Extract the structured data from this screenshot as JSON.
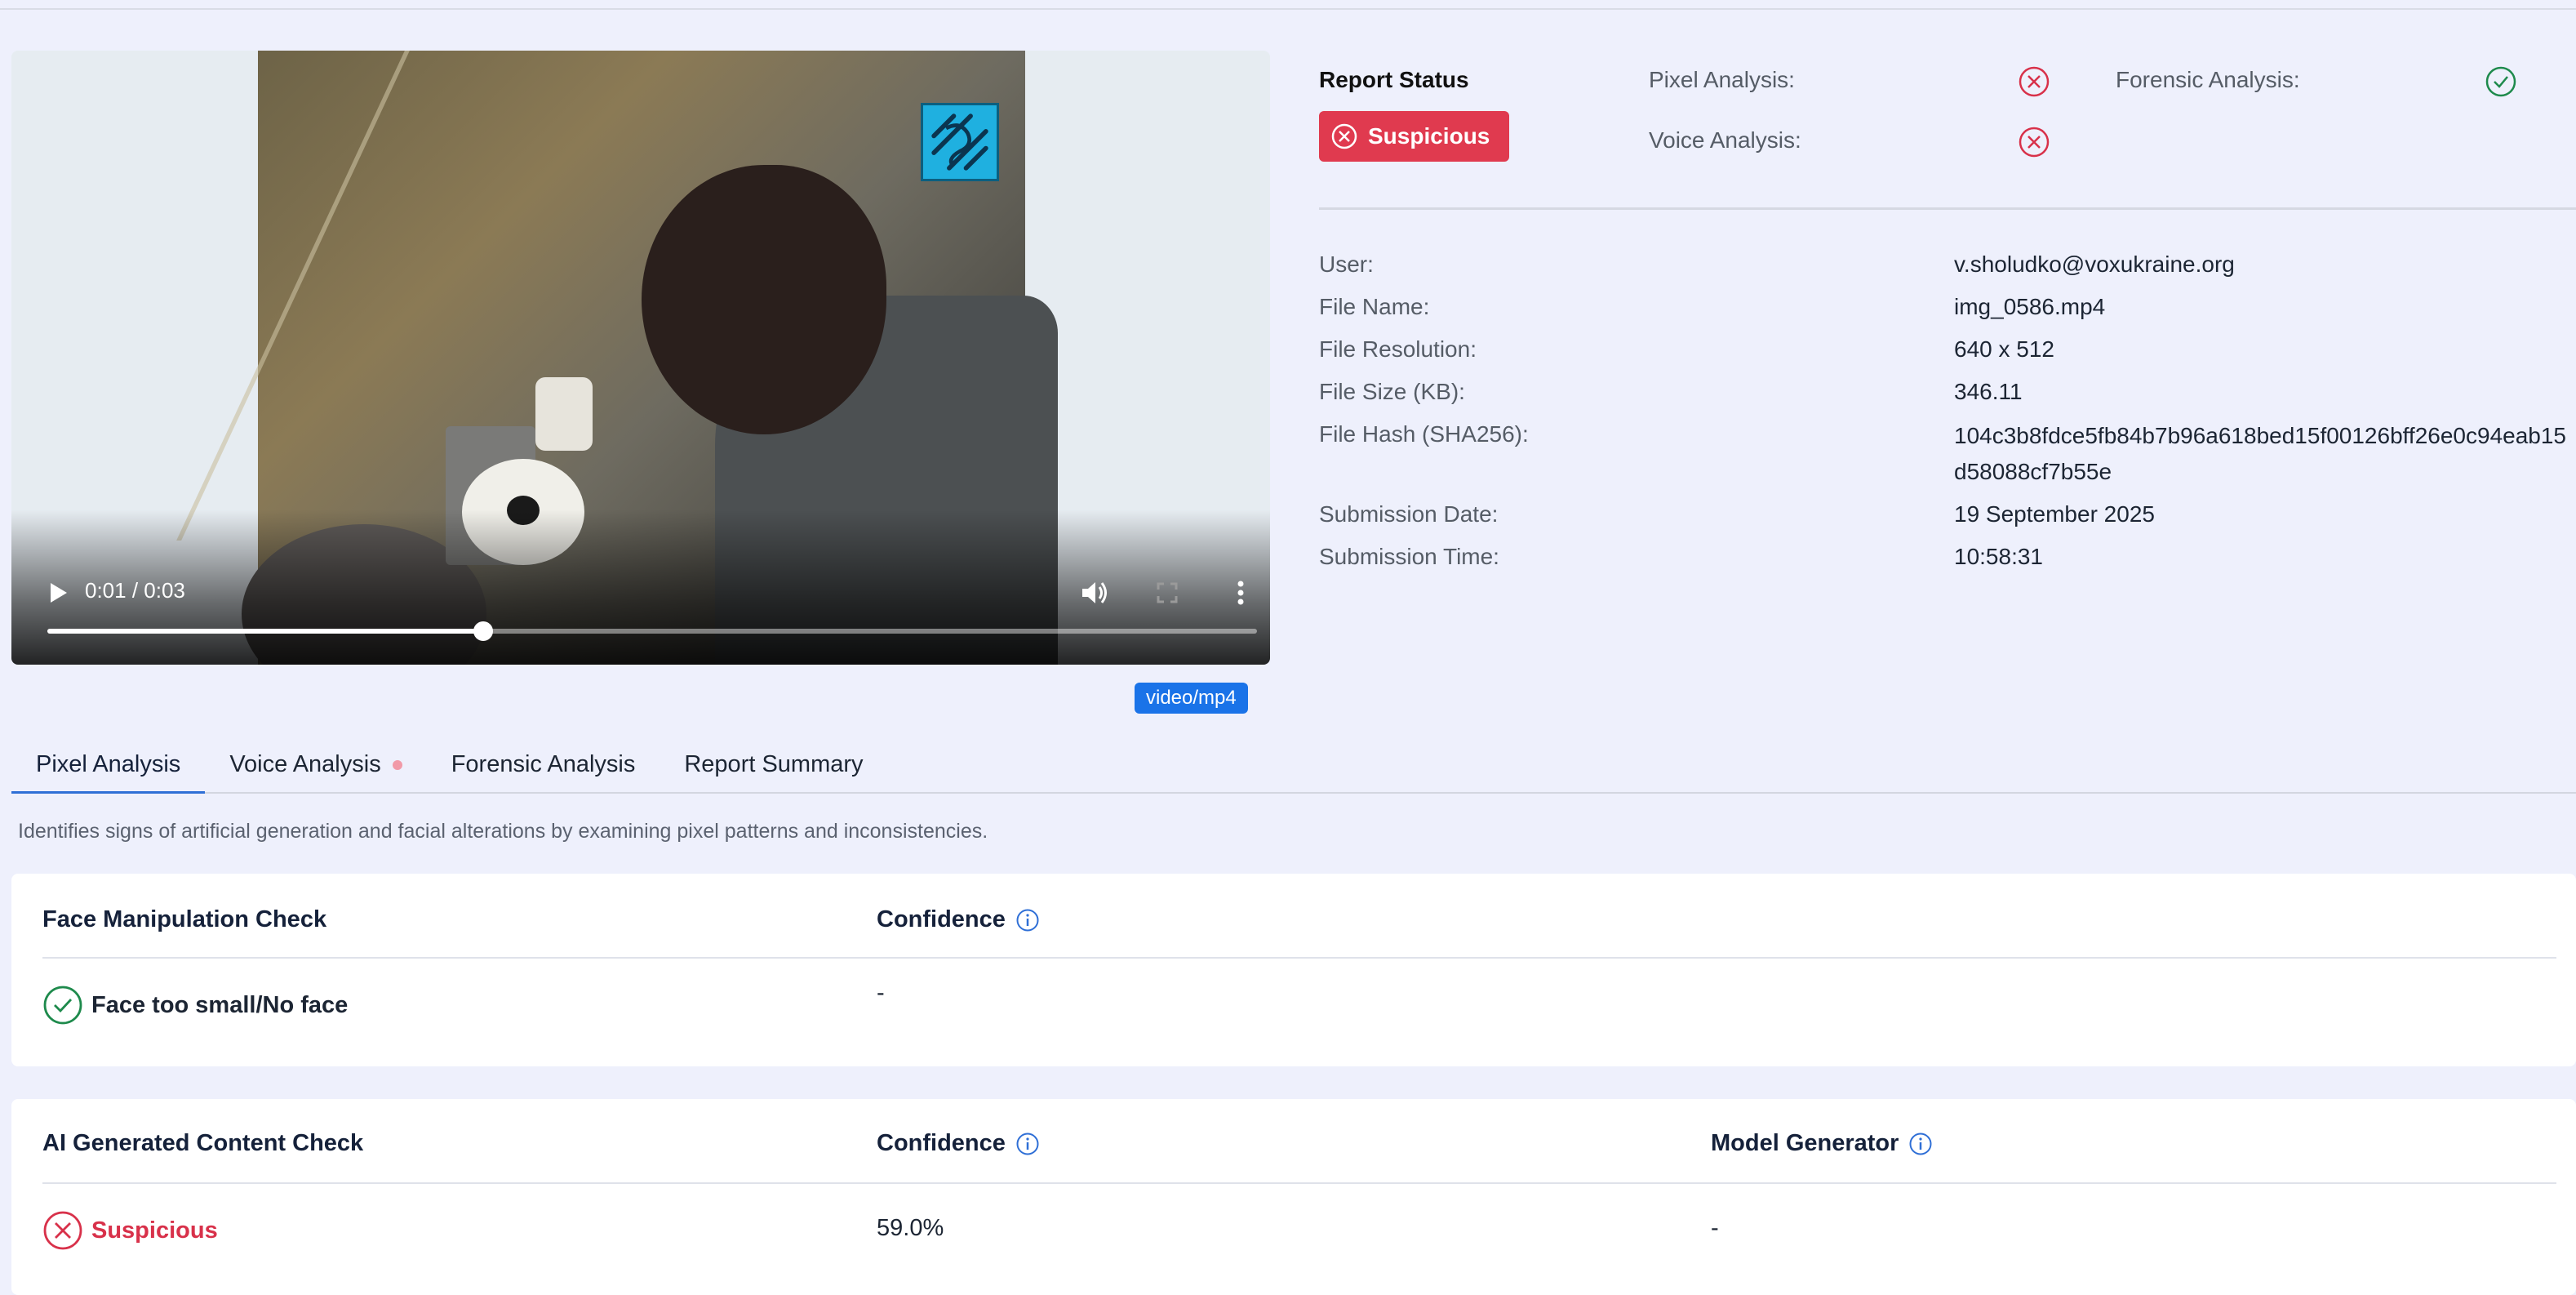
{
  "player": {
    "time_display": "0:01 / 0:03",
    "progress_fraction": 0.36,
    "mime_type": "video/mp4"
  },
  "report_status": {
    "title": "Report Status",
    "status": "Suspicious",
    "analyses": [
      {
        "label": "Pixel Analysis:",
        "result": "fail"
      },
      {
        "label": "Voice Analysis:",
        "result": "fail"
      },
      {
        "label": "Forensic Analysis:",
        "result": "pass"
      }
    ]
  },
  "metadata": [
    {
      "label": "User:",
      "value": "v.sholudko@voxukraine.org"
    },
    {
      "label": "File Name:",
      "value": "img_0586.mp4"
    },
    {
      "label": "File Resolution:",
      "value": "640 x 512"
    },
    {
      "label": "File Size (KB):",
      "value": "346.11"
    },
    {
      "label": "File Hash (SHA256):",
      "value": "104c3b8fdce5fb84b7b96a618bed15f00126bff26e0c94eab15d58088cf7b55e"
    },
    {
      "label": "Submission Date:",
      "value": "19 September 2025"
    },
    {
      "label": "Submission Time:",
      "value": "10:58:31"
    }
  ],
  "tabs": [
    {
      "label": "Pixel Analysis",
      "active": true
    },
    {
      "label": "Voice Analysis",
      "dot": true
    },
    {
      "label": "Forensic Analysis"
    },
    {
      "label": "Report Summary"
    }
  ],
  "description": "Identifies signs of artificial generation and facial alterations by examining pixel patterns and inconsistencies.",
  "face_check": {
    "title": "Face Manipulation Check",
    "confidence_header": "Confidence",
    "result": "Face too small/No face",
    "confidence": "-"
  },
  "ai_check": {
    "title": "AI Generated Content Check",
    "confidence_header": "Confidence",
    "model_header": "Model Generator",
    "result": "Suspicious",
    "confidence": "59.0%",
    "model": "-"
  },
  "colors": {
    "fail": "#d8314a",
    "pass": "#1e8a4c",
    "accent": "#1a73e8"
  }
}
